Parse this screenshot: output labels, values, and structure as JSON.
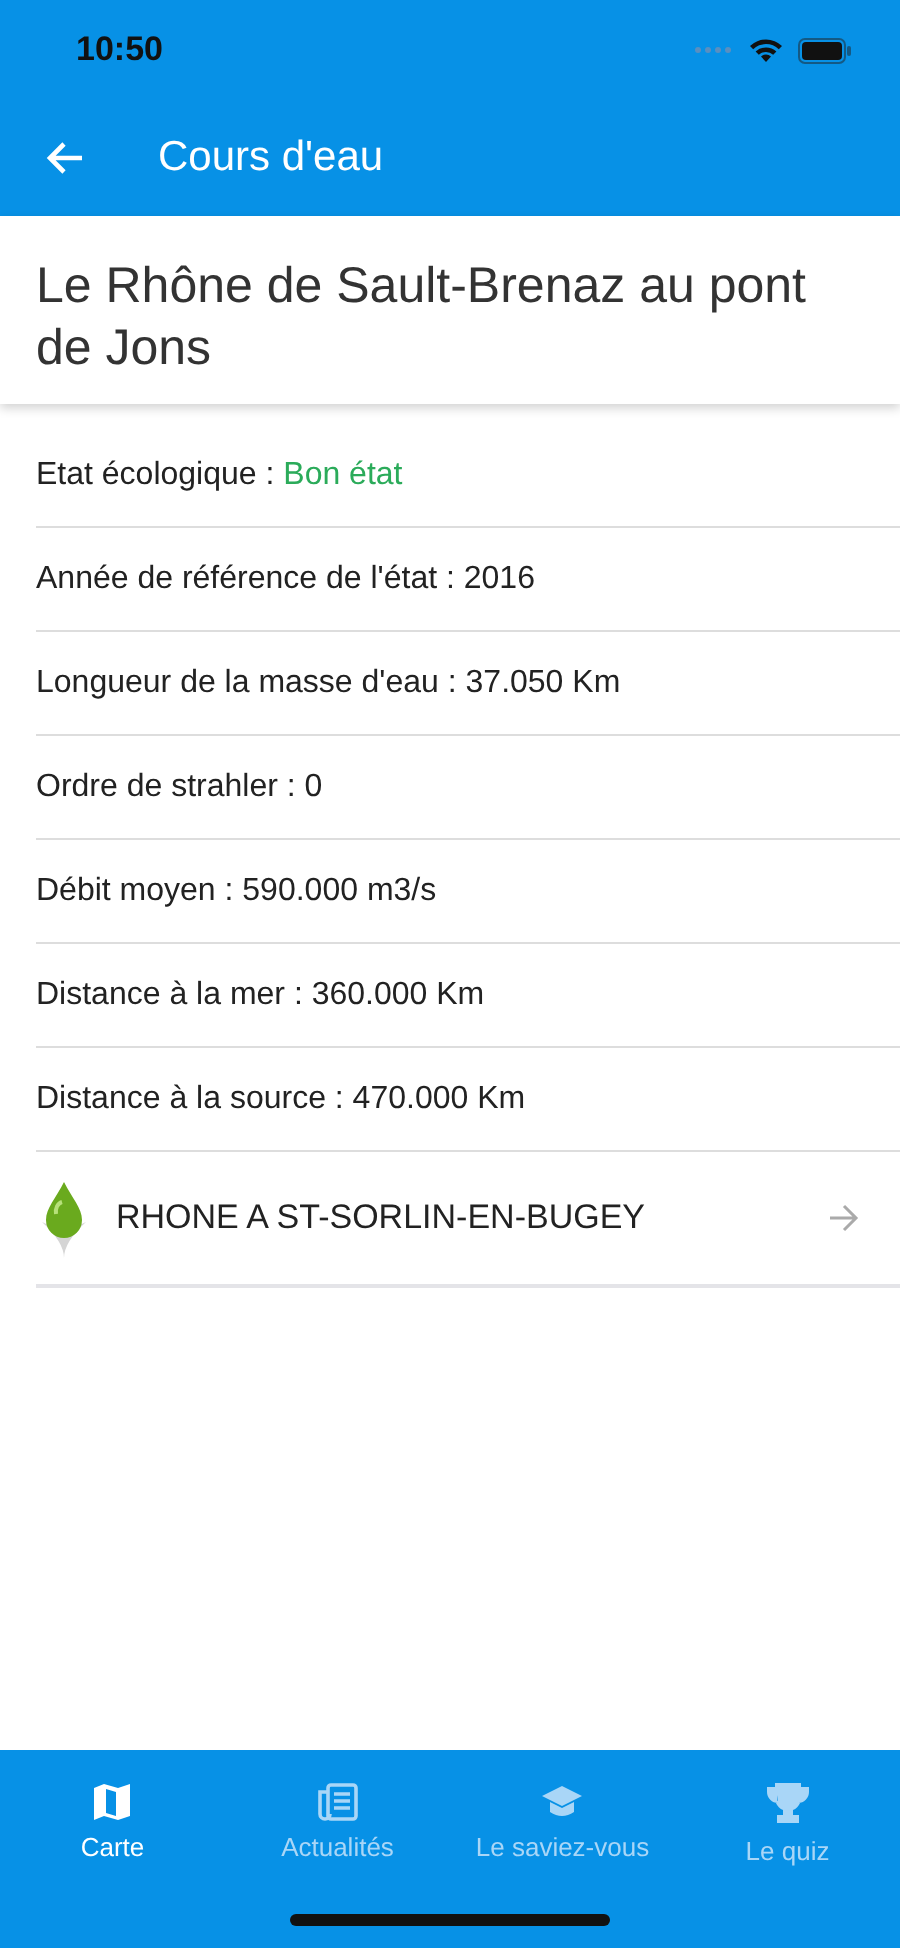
{
  "status_bar": {
    "time": "10:50"
  },
  "header": {
    "title": "Cours d'eau"
  },
  "page_title": "Le Rhône de Sault-Brenaz au pont de Jons",
  "properties": [
    {
      "label": "Etat écologique : ",
      "value": "Bon état",
      "kind": "status"
    },
    {
      "label": "Année de référence de l'état : ",
      "value": "2016",
      "kind": "plain"
    },
    {
      "label": "Longueur de la masse d'eau : ",
      "value": "37.050 Km",
      "kind": "plain"
    },
    {
      "label": "Ordre de strahler : ",
      "value": "0",
      "kind": "plain"
    },
    {
      "label": "Débit moyen : ",
      "value": "590.000 m3/s",
      "kind": "plain"
    },
    {
      "label": "Distance à la mer : ",
      "value": "360.000 Km",
      "kind": "plain"
    },
    {
      "label": "Distance à la source : ",
      "value": "470.000 Km",
      "kind": "plain"
    }
  ],
  "stations": [
    {
      "name": "RHONE A ST-SORLIN-EN-BUGEY"
    }
  ],
  "tabs": [
    {
      "label": "Carte",
      "kind": "map",
      "selected": true
    },
    {
      "label": "Actualités",
      "kind": "news",
      "selected": false
    },
    {
      "label": "Le saviez-vous",
      "kind": "cap",
      "selected": false
    },
    {
      "label": "Le quiz",
      "kind": "trophy",
      "selected": false
    }
  ]
}
